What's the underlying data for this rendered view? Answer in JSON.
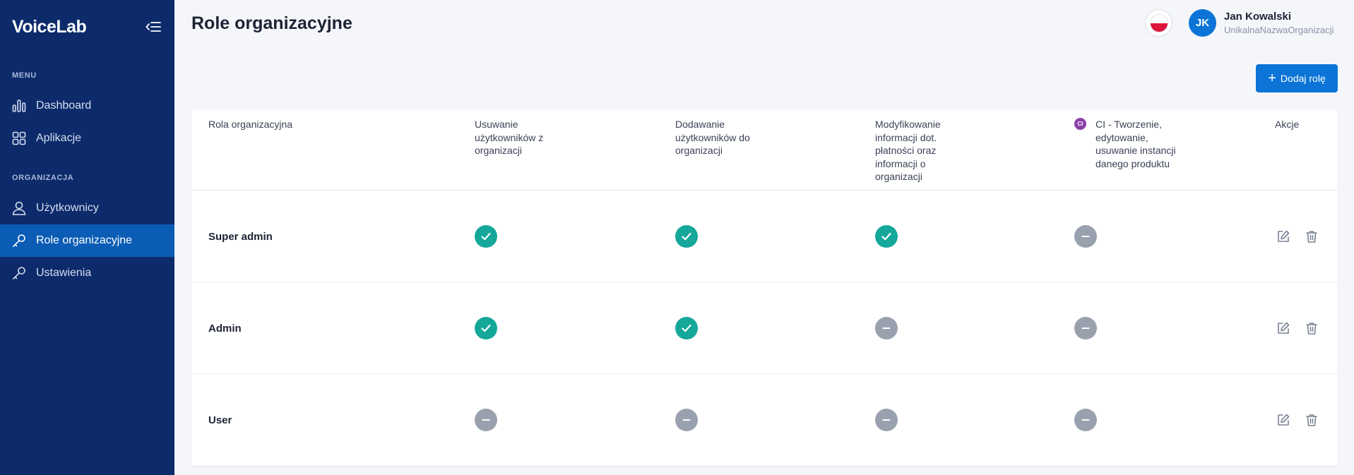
{
  "sidebar": {
    "logo": "VoiceLab",
    "menu_label": "MENU",
    "org_label": "ORGANIZACJA",
    "items": [
      {
        "label": "Dashboard",
        "icon": "bar-chart-icon"
      },
      {
        "label": "Aplikacje",
        "icon": "grid-icon"
      },
      {
        "label": "Użytkownicy",
        "icon": "user-icon"
      },
      {
        "label": "Role organizacyjne",
        "icon": "key-icon",
        "active": true
      },
      {
        "label": "Ustawienia",
        "icon": "key-icon"
      }
    ]
  },
  "header": {
    "title": "Role organizacyjne",
    "language_flag": "flag-icon",
    "user": {
      "initials": "JK",
      "name": "Jan Kowalski",
      "organization": "UnikalnaNazwaOrganizacji"
    },
    "add_role_label": "Dodaj rolę"
  },
  "table": {
    "columns": {
      "role": "Rola organizacyjna",
      "delete_users": "Usuwanie użytkowników z organizacji",
      "add_users": "Dodawanie użytkowników do organizacji",
      "modify_payment": "Modyfikowanie informacji dot. płatności oraz informacji o organizacji",
      "ci_badge": "CI",
      "ci_instances": "CI - Tworzenie, edytowanie, usuwanie instancji danego produktu",
      "actions": "Akcje"
    },
    "rows": [
      {
        "role": "Super admin",
        "perms": [
          true,
          true,
          true,
          false
        ]
      },
      {
        "role": "Admin",
        "perms": [
          true,
          true,
          false,
          false
        ]
      },
      {
        "role": "User",
        "perms": [
          false,
          false,
          false,
          false
        ]
      }
    ]
  },
  "colors": {
    "sidebar_bg": "#0d2b6b",
    "active_item_bg": "#0b5cb5",
    "accent": "#0b74d6",
    "granted": "#15a89a",
    "denied": "#9aa1ae"
  }
}
